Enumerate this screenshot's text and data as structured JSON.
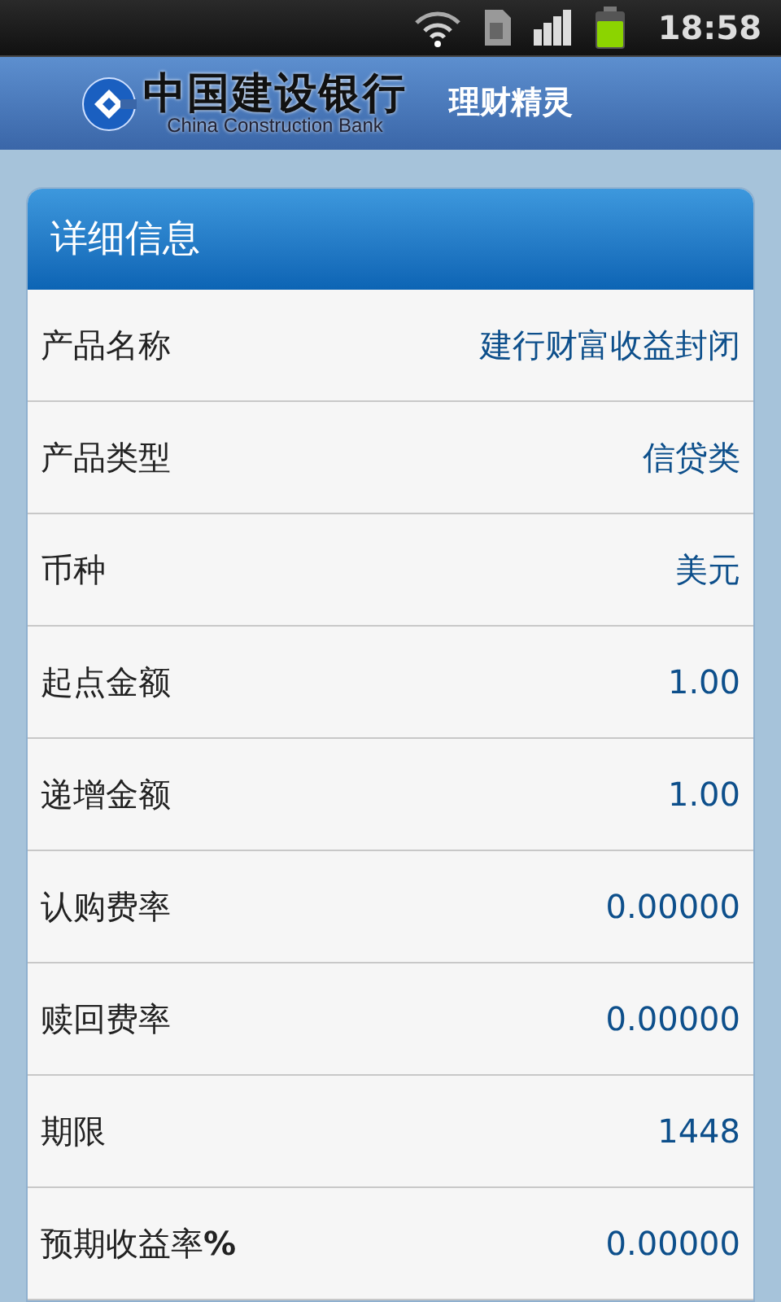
{
  "status_bar": {
    "time": "18:58"
  },
  "header": {
    "bank_name": "中国建设银行",
    "bank_name_en": "China Construction Bank",
    "app_name": "理财精灵"
  },
  "card": {
    "title": "详细信息",
    "rows": [
      {
        "label": "产品名称",
        "value": "建行财富收益封闭"
      },
      {
        "label": "产品类型",
        "value": "信贷类"
      },
      {
        "label": "币种",
        "value": "美元"
      },
      {
        "label": "起点金额",
        "value": "1.00"
      },
      {
        "label": "递增金额",
        "value": "1.00"
      },
      {
        "label": "认购费率",
        "value": "0.00000"
      },
      {
        "label": "赎回费率",
        "value": "0.00000"
      },
      {
        "label": "期限",
        "value": "1448"
      },
      {
        "label": "预期收益率**%**",
        "value": "0.00000"
      }
    ]
  }
}
